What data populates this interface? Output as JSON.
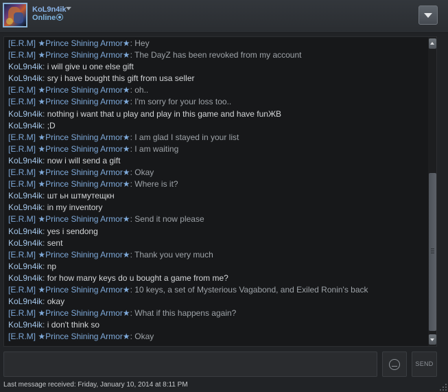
{
  "header": {
    "user_name": "KoL9n4ik",
    "status": "Online"
  },
  "chat": {
    "messages": [
      {
        "sender": "[E.R.M] ★Prince Shining Armor★",
        "text": "Hey",
        "self": false
      },
      {
        "sender": "[E.R.M] ★Prince Shining Armor★",
        "text": "The DayZ has been revoked from my account",
        "self": false
      },
      {
        "sender": "KoL9n4ik",
        "text": "i will give u one else gift",
        "self": true
      },
      {
        "sender": "KoL9n4ik",
        "text": "sry i have bought this gift from usa seller",
        "self": true
      },
      {
        "sender": "[E.R.M] ★Prince Shining Armor★",
        "text": "oh..",
        "self": false
      },
      {
        "sender": "[E.R.M] ★Prince Shining Armor★",
        "text": "I'm sorry for your loss too..",
        "self": false
      },
      {
        "sender": "KoL9n4ik",
        "text": "nothing i want that u play and play in this game and have  funЖВ",
        "self": true
      },
      {
        "sender": "KoL9n4ik",
        "text": ";D",
        "self": true
      },
      {
        "sender": "[E.R.M] ★Prince Shining Armor★",
        "text": "I am glad I stayed in your list",
        "self": false
      },
      {
        "sender": "[E.R.M] ★Prince Shining Armor★",
        "text": "I am waiting",
        "self": false
      },
      {
        "sender": "KoL9n4ik",
        "text": "now i will send a gift",
        "self": true
      },
      {
        "sender": "[E.R.M] ★Prince Shining Armor★",
        "text": "Okay",
        "self": false
      },
      {
        "sender": "[E.R.M] ★Prince Shining Armor★",
        "text": "Where is it?",
        "self": false
      },
      {
        "sender": "KoL9n4ik",
        "text": "шт ьн штмутещкн",
        "self": true
      },
      {
        "sender": "KoL9n4ik",
        "text": "in my inventory",
        "self": true
      },
      {
        "sender": "[E.R.M] ★Prince Shining Armor★",
        "text": "Send it now please",
        "self": false
      },
      {
        "sender": "KoL9n4ik",
        "text": "yes i sendong",
        "self": true
      },
      {
        "sender": "KoL9n4ik",
        "text": "sent",
        "self": true
      },
      {
        "sender": "[E.R.M] ★Prince Shining Armor★",
        "text": "Thank you very much",
        "self": false
      },
      {
        "sender": "KoL9n4ik",
        "text": "np",
        "self": true
      },
      {
        "sender": "KoL9n4ik",
        "text": "for how many keys do u bought a game from me?",
        "self": true
      },
      {
        "sender": "[E.R.M] ★Prince Shining Armor★",
        "text": "10 keys, a set of Mysterious Vagabond, and Exiled Ronin's back",
        "self": false
      },
      {
        "sender": "KoL9n4ik",
        "text": "okay",
        "self": true
      },
      {
        "sender": "[E.R.M] ★Prince Shining Armor★",
        "text": "What if this happens again?",
        "self": false
      },
      {
        "sender": "KoL9n4ik",
        "text": "i don't think so",
        "self": true
      },
      {
        "sender": "[E.R.M] ★Prince Shining Armor★",
        "text": "Okay",
        "self": false
      }
    ],
    "separator": ": "
  },
  "composer": {
    "input_value": "",
    "send_label": "SEND"
  },
  "footer": {
    "last_message": "Last message received: Friday, January 10, 2014 at 8:11 PM"
  }
}
